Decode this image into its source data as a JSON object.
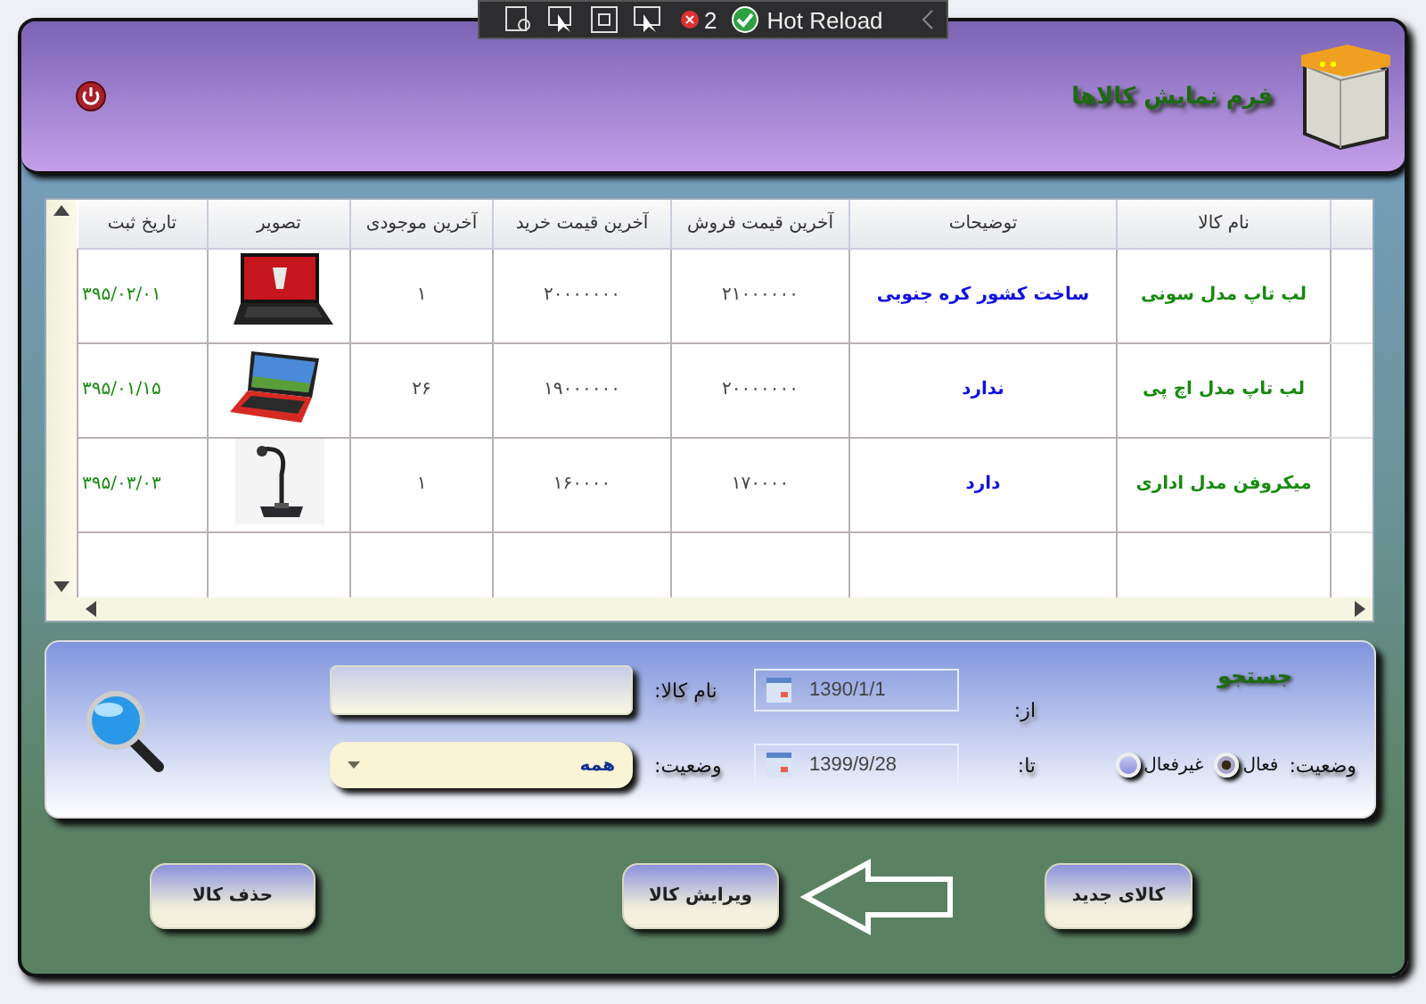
{
  "debug_toolbar": {
    "error_count": "2",
    "label": "Hot Reload"
  },
  "window": {
    "title": "فرم نمایش کالاها"
  },
  "table": {
    "columns": [
      "نام کالا",
      "توضیحات",
      "آخرین قیمت فروش",
      "آخرین قیمت خرید",
      "آخرین موجودی",
      "تصویر",
      "تاریخ ثبت"
    ],
    "rows": [
      {
        "name": "لب تاپ مدل سونی",
        "description": "ساخت کشور کره جنوبی",
        "sale_price": "۲۱۰۰۰۰۰۰",
        "purchase_price": "۲۰۰۰۰۰۰۰",
        "stock": "۱",
        "date": "۳۹۵/۰۲/۰۱"
      },
      {
        "name": "لب تاپ مدل اچ پی",
        "description": "ندارد",
        "sale_price": "۲۰۰۰۰۰۰۰",
        "purchase_price": "۱۹۰۰۰۰۰۰",
        "stock": "۲۶",
        "date": "۳۹۵/۰۱/۱۵"
      },
      {
        "name": "میکروفن مدل اداری",
        "description": "دارد",
        "sale_price": "۱۷۰۰۰۰",
        "purchase_price": "۱۶۰۰۰۰",
        "stock": "۱",
        "date": "۳۹۵/۰۳/۰۳"
      }
    ]
  },
  "search": {
    "title": "جستجو",
    "status_label": "وضعیت:",
    "radios": [
      {
        "label": "فعال",
        "selected": true
      },
      {
        "label": "غیرفعال",
        "selected": false
      }
    ],
    "from_label": "از:",
    "from_date": "1390/1/1",
    "to_label": "تا:",
    "to_date": "1399/9/28",
    "name_label": "نام کالا:",
    "status2_label": "وضعیت:",
    "status_value": "همه"
  },
  "buttons": [
    {
      "label": "کالای جدید"
    },
    {
      "label": "ویرایش کالا"
    },
    {
      "label": "حذف کالا"
    }
  ]
}
